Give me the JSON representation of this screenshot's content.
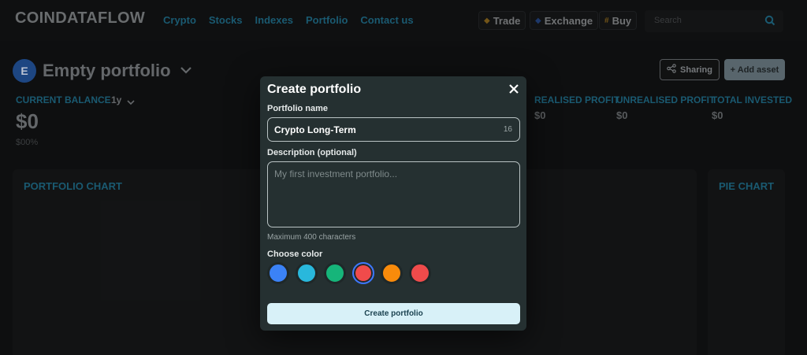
{
  "header": {
    "logo": "COINDATAFLOW",
    "nav": [
      "Crypto",
      "Stocks",
      "Indexes",
      "Portfolio",
      "Contact us"
    ],
    "trade_label": "Trade",
    "exchange_label": "Exchange",
    "buy_label": "Buy",
    "search_placeholder": "Search"
  },
  "portfolio": {
    "avatar_letter": "E",
    "title": "Empty portfolio",
    "sharing_label": "Sharing",
    "add_asset_label": "+ Add asset"
  },
  "stats": {
    "current_balance_label": "CURRENT BALANCE",
    "range": "1y",
    "balance_value": "$0",
    "balance_pct": "$00%",
    "realised_label": "REALISED PROFIT",
    "realised_value": "$0",
    "unrealised_label": "UNREALISED PROFIT",
    "unrealised_value": "$0",
    "invested_label": "TOTAL INVESTED",
    "invested_value": "$0"
  },
  "cards": {
    "portfolio_chart_title": "PORTFOLIO CHART",
    "pie_chart_title": "PIE CHART"
  },
  "modal": {
    "title": "Create portfolio",
    "name_label": "Portfolio name",
    "name_value": "Crypto Long-Term",
    "name_count": "16",
    "desc_label": "Description (optional)",
    "desc_placeholder": "My first investment portfolio...",
    "desc_help": "Maximum 400 characters",
    "color_label": "Choose color",
    "colors": [
      "#3b82f6",
      "#29b8dc",
      "#16b57a",
      "#f04b4b",
      "#f98b0b",
      "#f04b4b"
    ],
    "selected_color_index": 3,
    "submit_label": "Create portfolio"
  }
}
